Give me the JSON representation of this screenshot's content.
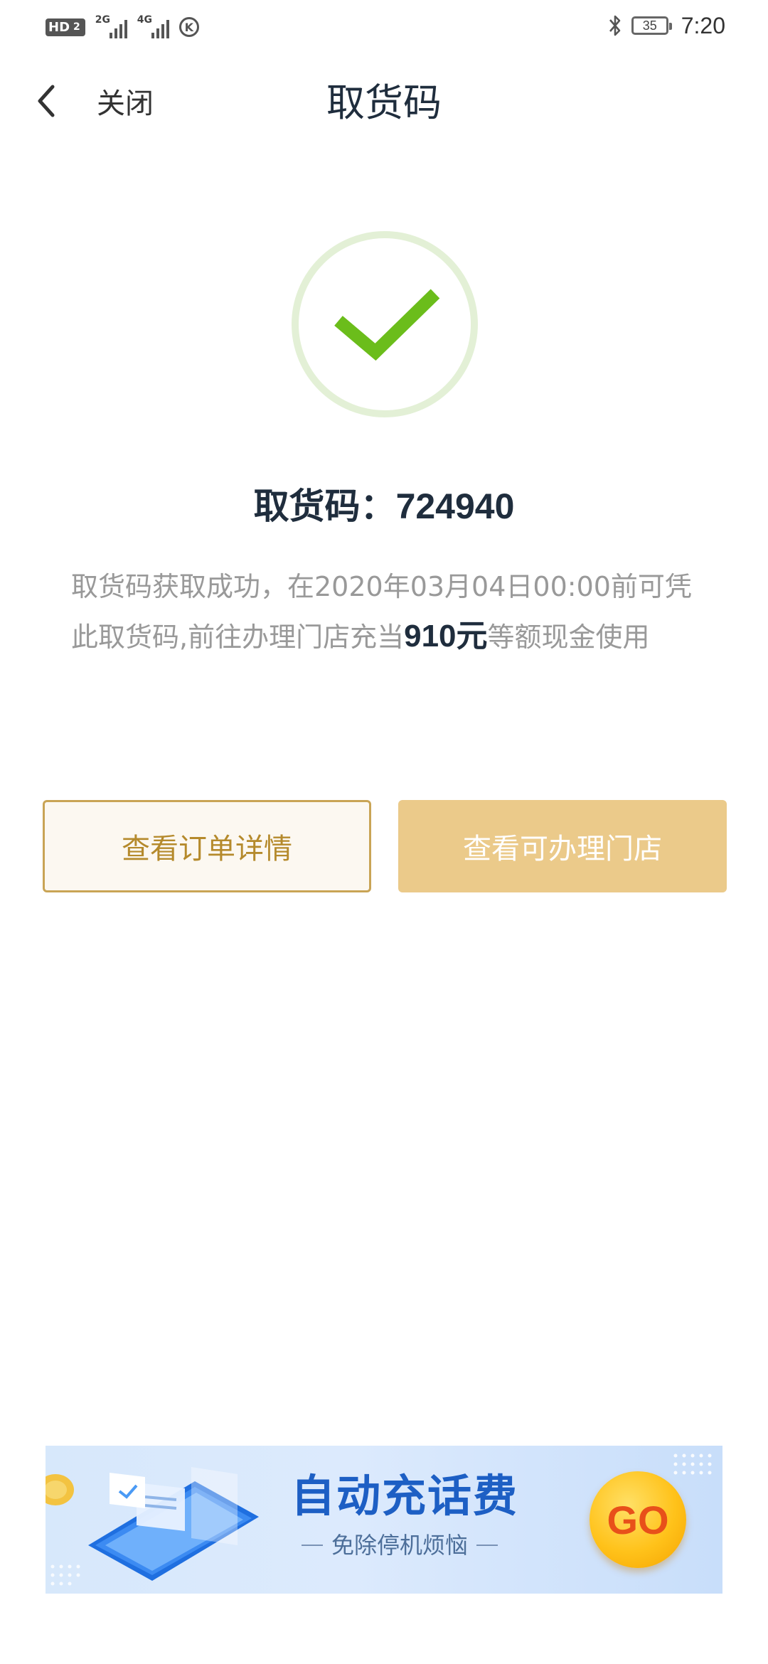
{
  "status_bar": {
    "hd_label": "HD",
    "hd_sub": "2",
    "net1_label": "2G",
    "net2_label": "4G",
    "k_icon_label": "K",
    "battery_level": "35",
    "time": "7:20"
  },
  "header": {
    "close_label": "关闭",
    "title": "取货码"
  },
  "code": {
    "label": "取货码：",
    "value": "724940"
  },
  "description": {
    "part1": "取货码获取成功，在2020年03月04日00:00前可凭此取货码,前往办理门店充当",
    "amount": "910元",
    "part2": "等额现金使用"
  },
  "buttons": {
    "order_details": "查看订单详情",
    "stores": "查看可办理门店"
  },
  "banner": {
    "title": "自动充话费",
    "subtitle": "免除停机烦恼",
    "go_label": "GO"
  },
  "colors": {
    "accent_gold": "#c9a455",
    "gold_fill": "#ebca8a",
    "success_green": "#6bbd1b",
    "banner_blue": "#1d5fc4"
  },
  "icons": [
    "back-icon",
    "check-icon",
    "bluetooth-icon",
    "battery-icon",
    "signal-icon"
  ]
}
